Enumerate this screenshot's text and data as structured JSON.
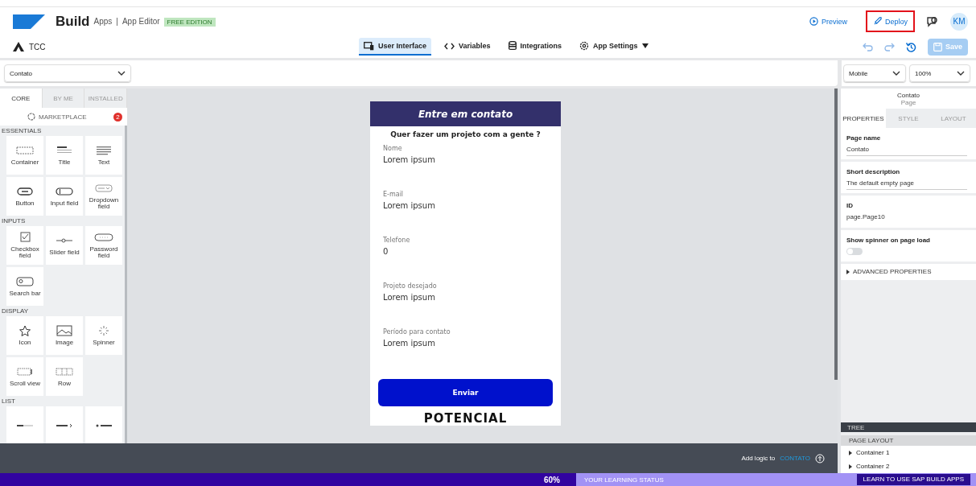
{
  "header": {
    "brand": "Build",
    "product": "Apps",
    "separator": "|",
    "editor": "App Editor",
    "edition_badge": "FREE EDITION",
    "actions": [
      {
        "label": "Preview",
        "kind": "preview",
        "highlighted": false
      },
      {
        "label": "Deploy",
        "kind": "deploy",
        "highlighted": true
      }
    ],
    "avatar": "KM"
  },
  "toolbar": {
    "project": "TCC",
    "tabs": [
      {
        "label": "User Interface",
        "kind": "ui",
        "selected": true
      },
      {
        "label": "Variables",
        "kind": "vars",
        "selected": false
      },
      {
        "label": "Integrations",
        "kind": "db",
        "selected": false
      },
      {
        "label": "App Settings",
        "kind": "settings",
        "selected": false
      }
    ],
    "save": {
      "label": "Save",
      "disabled": true
    }
  },
  "page_select": {
    "value": "Contato"
  },
  "device_select": {
    "value": "Mobile"
  },
  "zoom_select": {
    "value": "100%"
  },
  "palette": {
    "tabs": [
      {
        "label": "CORE",
        "selected": true
      },
      {
        "label": "BY ME",
        "selected": false
      },
      {
        "label": "INSTALLED",
        "selected": false
      }
    ],
    "marketplace": {
      "label": "MARKETPLACE",
      "badge": "2"
    },
    "sections": [
      {
        "title": "ESSENTIALS",
        "items": [
          {
            "label": "Container",
            "kind": "container"
          },
          {
            "label": "Title",
            "kind": "title"
          },
          {
            "label": "Text",
            "kind": "text"
          },
          {
            "label": "Button",
            "kind": "button"
          },
          {
            "label": "Input field",
            "kind": "input"
          },
          {
            "label": "Dropdown field",
            "kind": "dropdown"
          }
        ]
      },
      {
        "title": "INPUTS",
        "items": [
          {
            "label": "Checkbox field",
            "kind": "checkbox"
          },
          {
            "label": "Slider field",
            "kind": "slider"
          },
          {
            "label": "Password field",
            "kind": "password"
          },
          {
            "label": "Search bar",
            "kind": "search"
          }
        ]
      },
      {
        "title": "DISPLAY",
        "items": [
          {
            "label": "Icon",
            "kind": "icon"
          },
          {
            "label": "Image",
            "kind": "image"
          },
          {
            "label": "Spinner",
            "kind": "spinner"
          },
          {
            "label": "Scroll view",
            "kind": "scroll"
          },
          {
            "label": "Row",
            "kind": "row"
          }
        ]
      },
      {
        "title": "LIST",
        "items": [
          {
            "kind": "list1"
          },
          {
            "kind": "list2"
          },
          {
            "kind": "list3"
          }
        ]
      }
    ]
  },
  "phone": {
    "title": "Entre em contato",
    "subtitle": "Quer fazer um projeto com a gente ?",
    "fields": [
      {
        "label": "Nome",
        "value": "Lorem ipsum"
      },
      {
        "label": "E-mail",
        "value": "Lorem ipsum"
      },
      {
        "label": "Telefone",
        "value": "0"
      },
      {
        "label": "Projeto desejado",
        "value": "Lorem ipsum"
      },
      {
        "label": "Período para contato",
        "value": "Lorem ipsum"
      }
    ],
    "button": "Enviar",
    "logo": "POTENCIAL"
  },
  "logic_bar": {
    "label": "Add logic to",
    "target": "CONTATO"
  },
  "properties": {
    "title": "Contato",
    "subtitle": "Page",
    "tabs": [
      {
        "label": "PROPERTIES",
        "selected": true
      },
      {
        "label": "STYLE",
        "selected": false
      },
      {
        "label": "LAYOUT",
        "selected": false
      }
    ],
    "page_name": {
      "label": "Page name",
      "value": "Contato"
    },
    "short_description": {
      "label": "Short description",
      "value": "The default empty page"
    },
    "id": {
      "label": "ID",
      "value": "page.Page10"
    },
    "spinner": {
      "label": "Show spinner on page load",
      "on": false
    },
    "advanced": "ADVANCED PROPERTIES"
  },
  "tree": {
    "title": "TREE",
    "section": "PAGE LAYOUT",
    "items": [
      {
        "label": "Container 1"
      },
      {
        "label": "Container 2"
      }
    ]
  },
  "learning_bar": {
    "percent": "60%",
    "label": "YOUR LEARNING STATUS",
    "button": "LEARN TO USE SAP BUILD APPS"
  }
}
